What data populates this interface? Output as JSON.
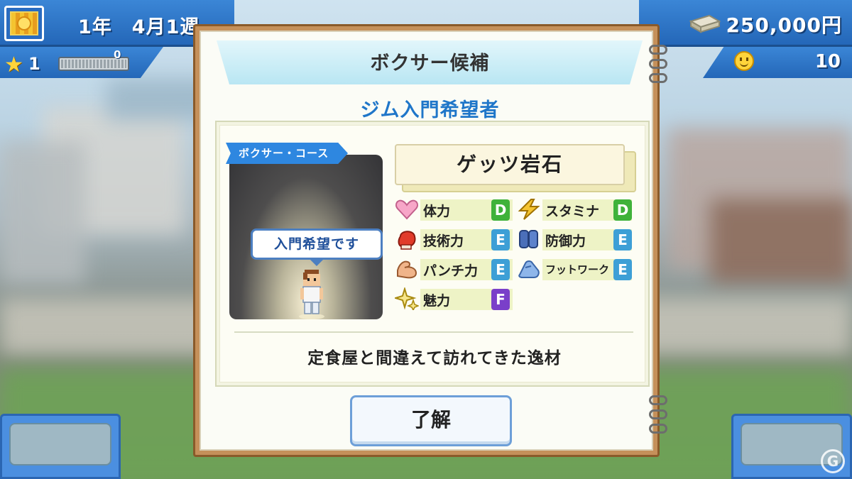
{
  "hud": {
    "date": "1年　4月1週",
    "money": "250,000円",
    "rank": "1",
    "exp": "0",
    "fans": "10"
  },
  "dialog": {
    "title": "ボクサー候補",
    "subtitle": "ジム入門希望者",
    "course_tag": "ボクサー・コース",
    "speech": "入門希望です",
    "name": "ゲッツ岩石",
    "stats": [
      {
        "label": "体力",
        "grade": "D",
        "icon": "heart-icon"
      },
      {
        "label": "スタミナ",
        "grade": "D",
        "icon": "lightning-icon"
      },
      {
        "label": "技術力",
        "grade": "E",
        "icon": "boxing-glove-icon"
      },
      {
        "label": "防御力",
        "grade": "E",
        "icon": "guard-icon"
      },
      {
        "label": "パンチ力",
        "grade": "E",
        "icon": "flexed-arm-icon"
      },
      {
        "label": "フットワーク",
        "grade": "E",
        "icon": "shoe-icon"
      },
      {
        "label": "魅力",
        "grade": "F",
        "icon": "sparkle-icon"
      }
    ],
    "description": "定食屋と間違えて訪れてきた逸材",
    "ok_label": "了解"
  },
  "colors": {
    "grade_D": "#3fb23a",
    "grade_E": "#3d9fd6",
    "grade_F": "#7a3fc9",
    "subtitle": "#1f76c9",
    "hud_blue": "#2a72c4"
  }
}
